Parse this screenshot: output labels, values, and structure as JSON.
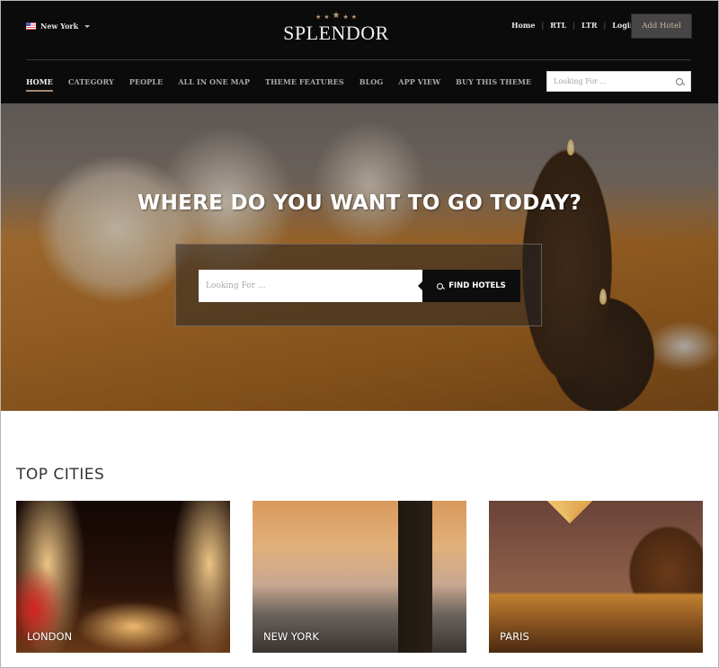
{
  "header": {
    "city_selector": {
      "flag": "us-flag-icon",
      "label": "New York"
    },
    "logo": {
      "stars": 5,
      "text": "SPLENDOR"
    },
    "top_links": [
      {
        "label": "Home"
      },
      {
        "label": "RTL"
      },
      {
        "label": "LTR"
      },
      {
        "label": "Login"
      }
    ],
    "add_hotel_label": "Add Hotel",
    "nav": [
      {
        "label": "HOME",
        "active": true
      },
      {
        "label": "CATEGORY"
      },
      {
        "label": "PEOPLE"
      },
      {
        "label": "ALL IN ONE MAP"
      },
      {
        "label": "THEME FEATURES"
      },
      {
        "label": "BLOG"
      },
      {
        "label": "APP VIEW"
      },
      {
        "label": "BUY THIS THEME"
      }
    ],
    "search": {
      "placeholder": "Looking For ...",
      "icon": "search-icon"
    }
  },
  "hero": {
    "title": "WHERE DO YOU WANT TO GO TODAY?",
    "search_placeholder": "Looking For ...",
    "find_button_label": "FIND HOTELS"
  },
  "top_cities": {
    "title": "TOP CITIES",
    "cities": [
      {
        "name": "LONDON"
      },
      {
        "name": "NEW YORK"
      },
      {
        "name": "PARIS"
      }
    ]
  },
  "colors": {
    "header_bg": "#0b0b0b",
    "accent": "#a38b6d",
    "add_hotel_bg": "#474545",
    "find_button_bg": "#0d0d0d"
  }
}
